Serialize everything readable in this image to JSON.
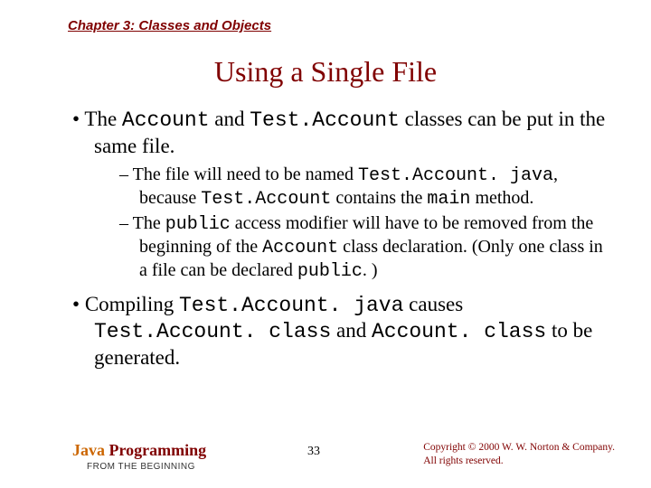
{
  "chapter": "Chapter 3: Classes and Objects",
  "title": "Using a Single File",
  "bullet1": {
    "pre": "The ",
    "code1": "Account",
    "mid1": " and ",
    "code2": "Test.Account",
    "post": " classes can be put in the same file."
  },
  "sub1": {
    "pre": "The file will need to be named ",
    "code1": "Test.Account. java",
    "mid1": ", because ",
    "code2": "Test.Account",
    "mid2": " contains the ",
    "code3": "main",
    "post": " method."
  },
  "sub2": {
    "pre": "The ",
    "code1": "public",
    "mid1": " access modifier will have to be removed from the beginning of the ",
    "code2": "Account",
    "mid2": " class declaration. (Only one class in a file can be declared ",
    "code3": "public",
    "post": ". )"
  },
  "bullet2": {
    "pre": "Compiling ",
    "code1": "Test.Account. java",
    "mid1": " causes ",
    "code2": "Test.Account. class",
    "mid2": " and ",
    "code3": "Account. class",
    "post": " to be generated."
  },
  "footer": {
    "book_word1": "Java",
    "book_word2": " Programming",
    "book_sub": "FROM THE BEGINNING",
    "page": "33",
    "copyright_line1": "Copyright © 2000 W. W. Norton & Company.",
    "copyright_line2": "All rights reserved."
  }
}
